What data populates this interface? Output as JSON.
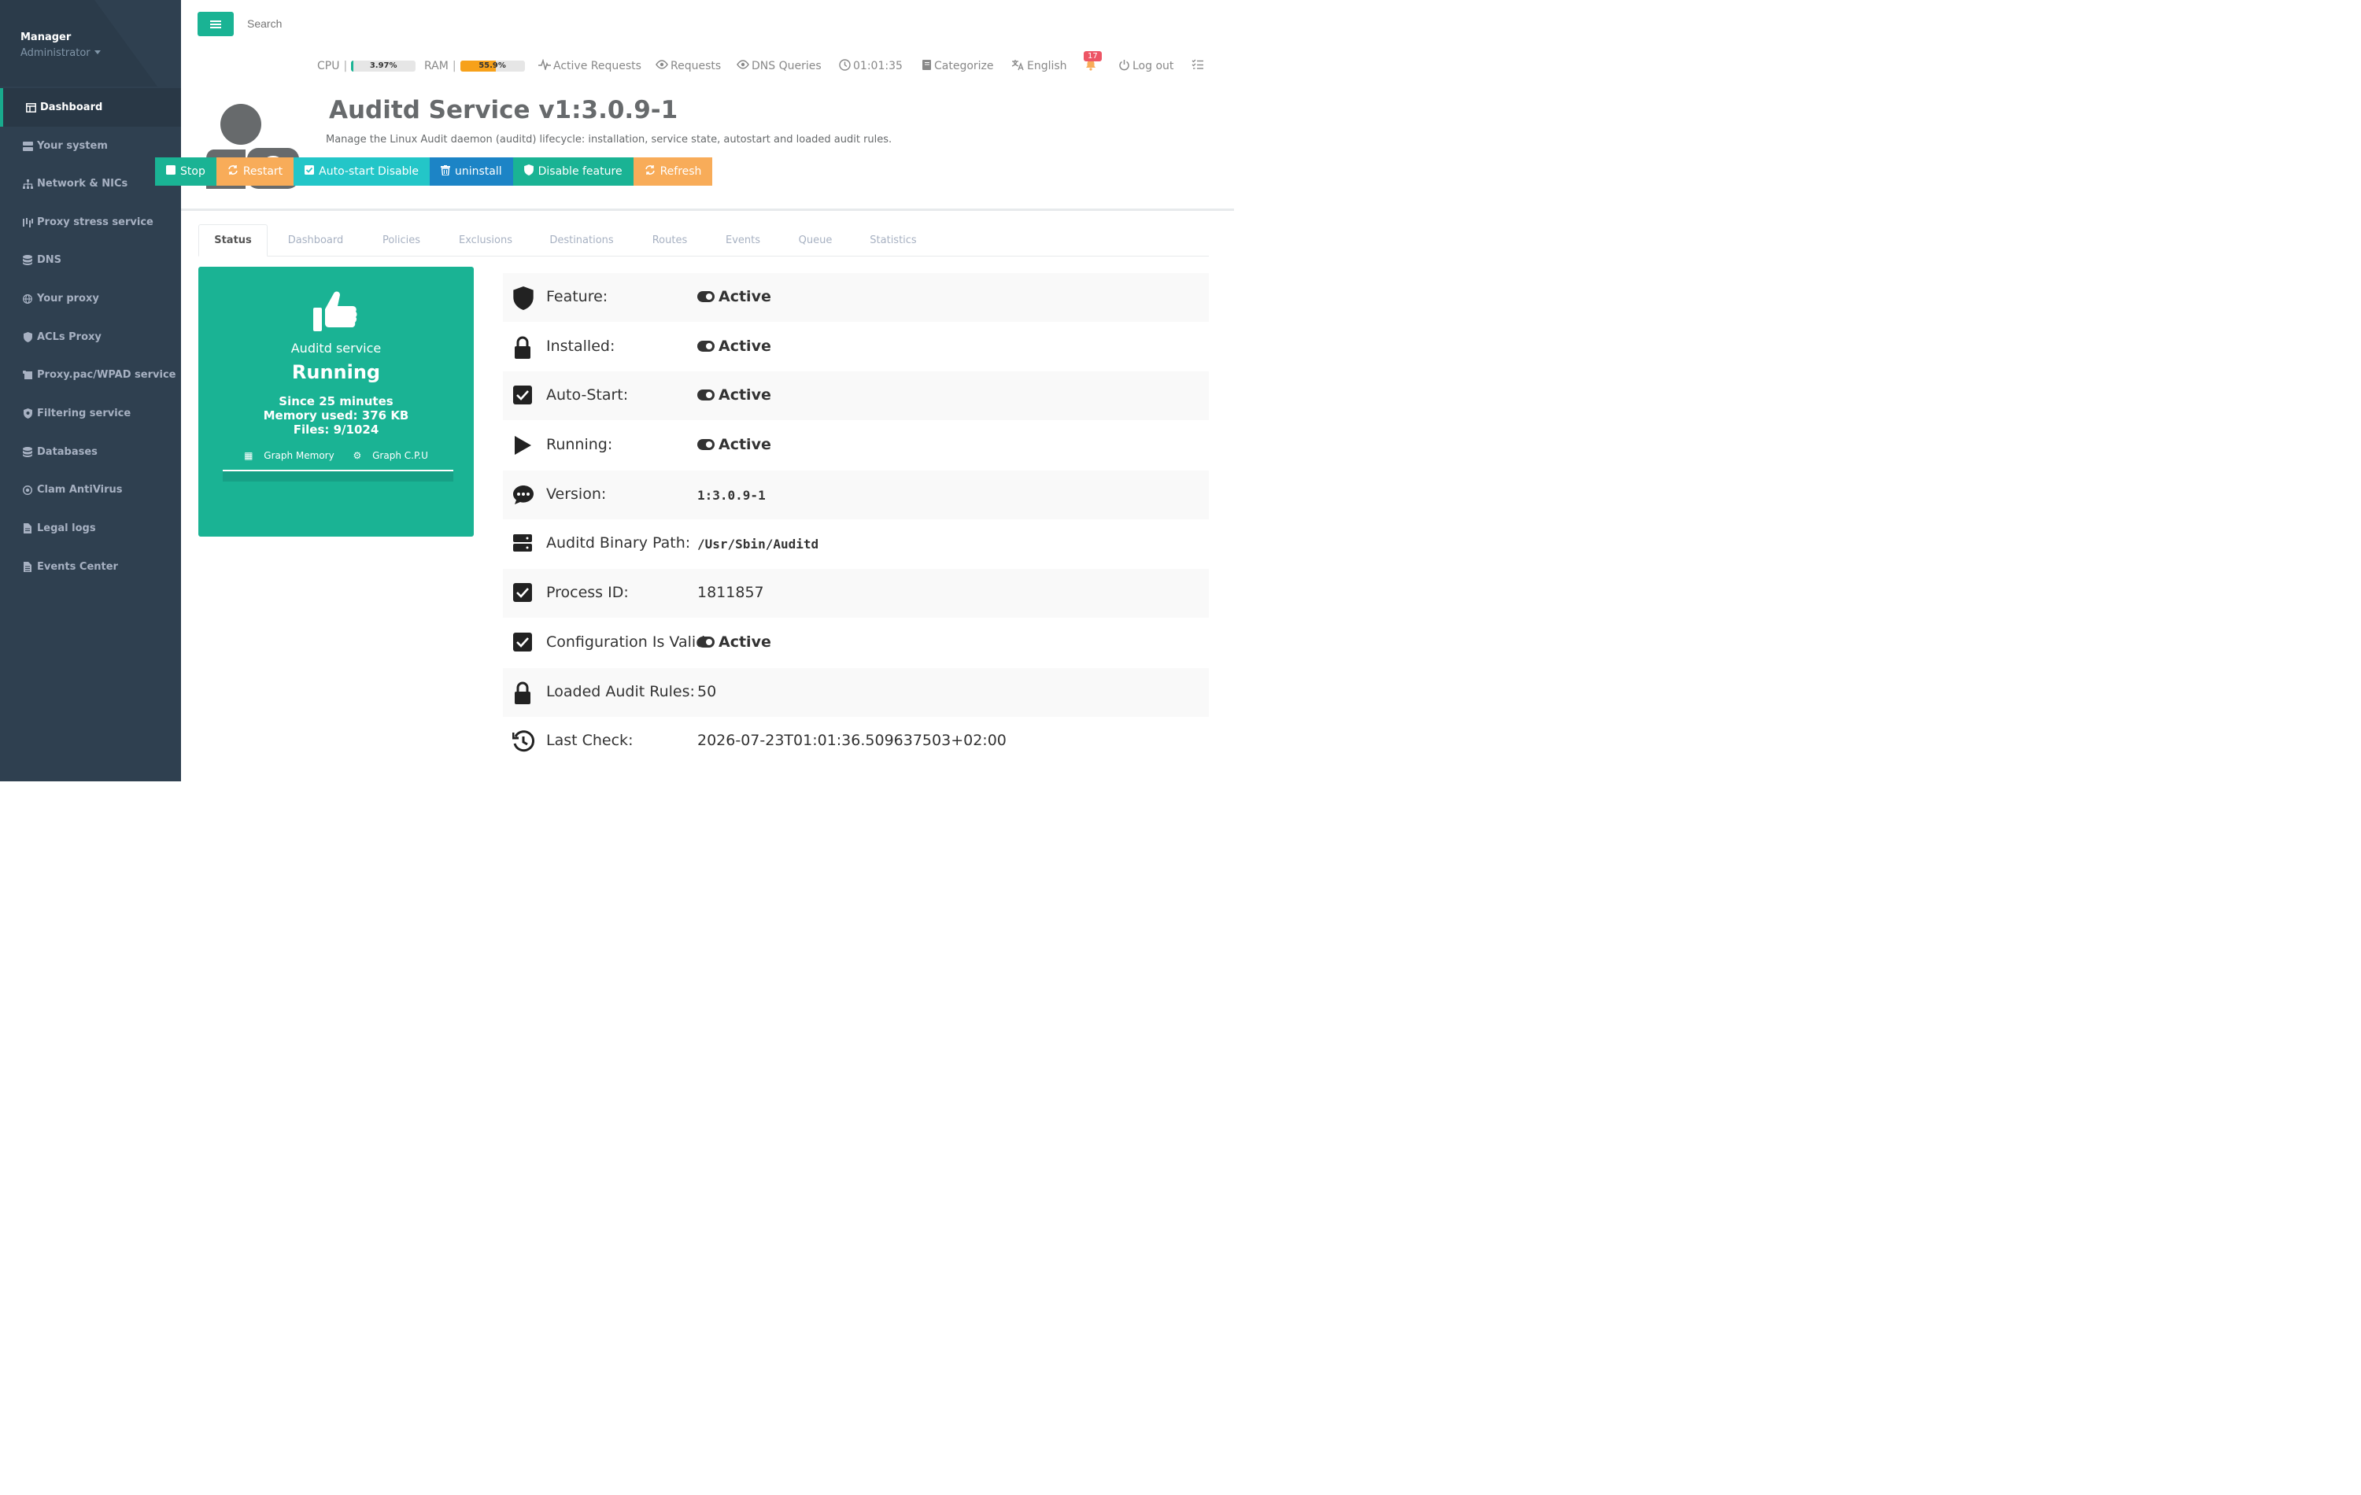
{
  "sidebar": {
    "profile": {
      "name": "Manager",
      "role": "Administrator"
    },
    "items": [
      {
        "label": "Dashboard",
        "icon": "dashboard-icon",
        "active": true
      },
      {
        "label": "Your system",
        "icon": "server-icon"
      },
      {
        "label": "Network & NICs",
        "icon": "network-icon"
      },
      {
        "label": "Proxy stress service",
        "icon": "stress-icon"
      },
      {
        "label": "DNS",
        "icon": "database-icon"
      },
      {
        "label": "Your proxy",
        "icon": "globe-icon"
      },
      {
        "label": "ACLs Proxy",
        "icon": "shield-icon"
      },
      {
        "label": "Proxy.pac/WPAD service",
        "icon": "scroll-icon"
      },
      {
        "label": "Filtering service",
        "icon": "shield-virus-icon"
      },
      {
        "label": "Databases",
        "icon": "database-icon"
      },
      {
        "label": "Clam AntiVirus",
        "icon": "virus-icon"
      },
      {
        "label": "Legal logs",
        "icon": "file-icon"
      },
      {
        "label": "Events Center",
        "icon": "file-lines-icon"
      }
    ]
  },
  "topbar": {
    "search_placeholder": "Search",
    "cpu_label": "CPU",
    "cpu_value": "3.97%",
    "cpu_fraction": 0.0397,
    "ram_label": "RAM",
    "ram_value": "55.9%",
    "ram_fraction": 0.559,
    "active_requests": "Active Requests",
    "requests": "Requests",
    "dns_queries": "DNS Queries",
    "clock": "01:01:35",
    "categorize": "Categorize",
    "language": "English",
    "notifications": "17",
    "logout": "Log out",
    "sep": "|"
  },
  "header": {
    "title": "Auditd Service v1:3.0.9-1",
    "subtitle": "Manage the Linux Audit daemon (auditd) lifecycle: installation, service state, autostart and loaded audit rules."
  },
  "actions": {
    "stop": "Stop",
    "restart": "Restart",
    "autostart": "Auto-start Disable",
    "uninstall": "uninstall",
    "disable": "Disable feature",
    "refresh": "Refresh"
  },
  "tabs": [
    "Status",
    "Dashboard",
    "Policies",
    "Exclusions",
    "Destinations",
    "Routes",
    "Events",
    "Queue",
    "Statistics"
  ],
  "status_card": {
    "service": "Auditd service",
    "state": "Running",
    "since": "Since 25 minutes",
    "memory": "Memory used: 376 KB",
    "files": "Files: 9/1024",
    "graph_memory": "Graph Memory",
    "graph_cpu": "Graph C.P.U"
  },
  "info_rows": [
    {
      "label": "Feature:",
      "value": "Active",
      "icon": "shield-icon"
    },
    {
      "label": "Installed:",
      "value": "Active",
      "icon": "lock-icon"
    },
    {
      "label": "Auto-Start:",
      "value": "Active",
      "icon": "checkbox-icon"
    },
    {
      "label": "Running:",
      "value": "Active",
      "icon": "play-icon"
    },
    {
      "label": "Version:",
      "value": "1:3.0.9-1",
      "icon": "comment-icon"
    },
    {
      "label": "Auditd Binary Path:",
      "value": "/Usr/Sbin/Auditd",
      "icon": "server-icon"
    },
    {
      "label": "Process ID:",
      "value": "1811857",
      "icon": "checkbox-icon"
    },
    {
      "label": "Configuration Is Valid:",
      "value": "Active",
      "icon": "checkbox-icon"
    },
    {
      "label": "Loaded Audit Rules:",
      "value": "50",
      "icon": "lock-icon"
    },
    {
      "label": "Last Check:",
      "value": "2026-07-23T01:01:36.509637503+02:00",
      "icon": "clock-history-icon"
    }
  ],
  "colors": {
    "primary": "#1ab394",
    "sidebar": "#2f4050",
    "warning": "#f8ac59",
    "info": "#23c6c8",
    "success_blue": "#1c84c6",
    "danger": "#ed5565"
  }
}
